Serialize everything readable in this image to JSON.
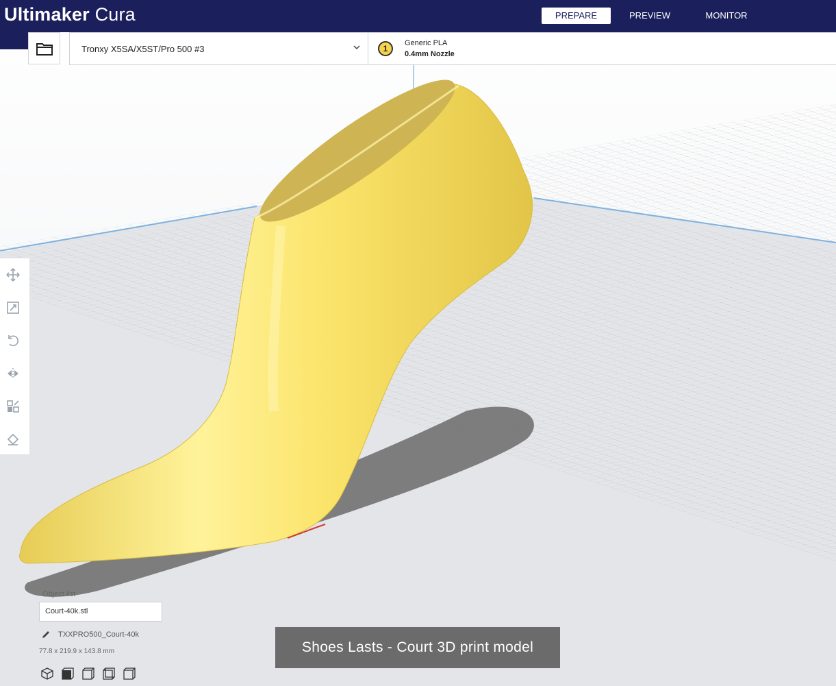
{
  "app": {
    "title_brand": "Ultimaker",
    "title_product": "Cura"
  },
  "stages": [
    {
      "label": "PREPARE",
      "active": true
    },
    {
      "label": "PREVIEW",
      "active": false
    },
    {
      "label": "MONITOR",
      "active": false
    }
  ],
  "printer": {
    "name": "Tronxy X5SA/X5ST/Pro 500 #3"
  },
  "extruder": {
    "number": "1",
    "material": "Generic PLA",
    "nozzle": "0.4mm Nozzle"
  },
  "tools": [
    "move-icon",
    "scale-icon",
    "rotate-icon",
    "mirror-icon",
    "per-model-settings-icon",
    "support-blocker-icon"
  ],
  "object_list": {
    "toggle_label": "Object list",
    "selected_file": "Court-40k.stl"
  },
  "job": {
    "name": "TXXPRO500_Court-40k",
    "dimensions": "77.8 x 219.9 x 143.8 mm"
  },
  "view_buttons": [
    "3d-view-icon",
    "front-view-icon",
    "top-view-icon",
    "left-view-icon",
    "right-view-icon"
  ],
  "caption": "Shoes Lasts - Court 3D print model",
  "colors": {
    "header": "#1b1f5c",
    "model": "#f7e46a",
    "build_plate": "#c9cbcf"
  }
}
